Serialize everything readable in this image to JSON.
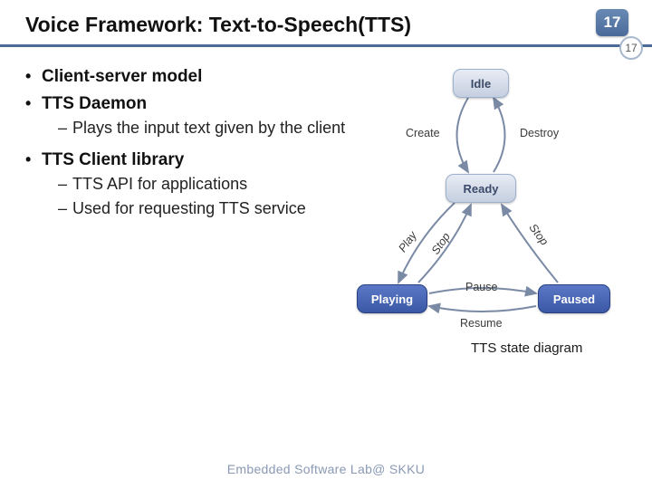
{
  "header": {
    "title": "Voice Framework: Text-to-Speech(TTS)",
    "page_number_main": "17",
    "page_number_sub": "17"
  },
  "bullets": {
    "item1": "Client-server model",
    "item2": "TTS Daemon",
    "item2_sub1": "Plays the input text given by the client",
    "item3": "TTS Client library",
    "item3_sub1": "TTS API for applications",
    "item3_sub2": "Used for requesting TTS service"
  },
  "diagram": {
    "nodes": {
      "idle": "Idle",
      "ready": "Ready",
      "playing": "Playing",
      "paused": "Paused"
    },
    "edges": {
      "create": "Create",
      "destroy": "Destroy",
      "play": "Play",
      "stop_from_playing": "Stop",
      "stop_from_paused": "Stop",
      "pause": "Pause",
      "resume": "Resume"
    },
    "caption": "TTS state diagram"
  },
  "footer": "Embedded Software Lab@ SKKU"
}
